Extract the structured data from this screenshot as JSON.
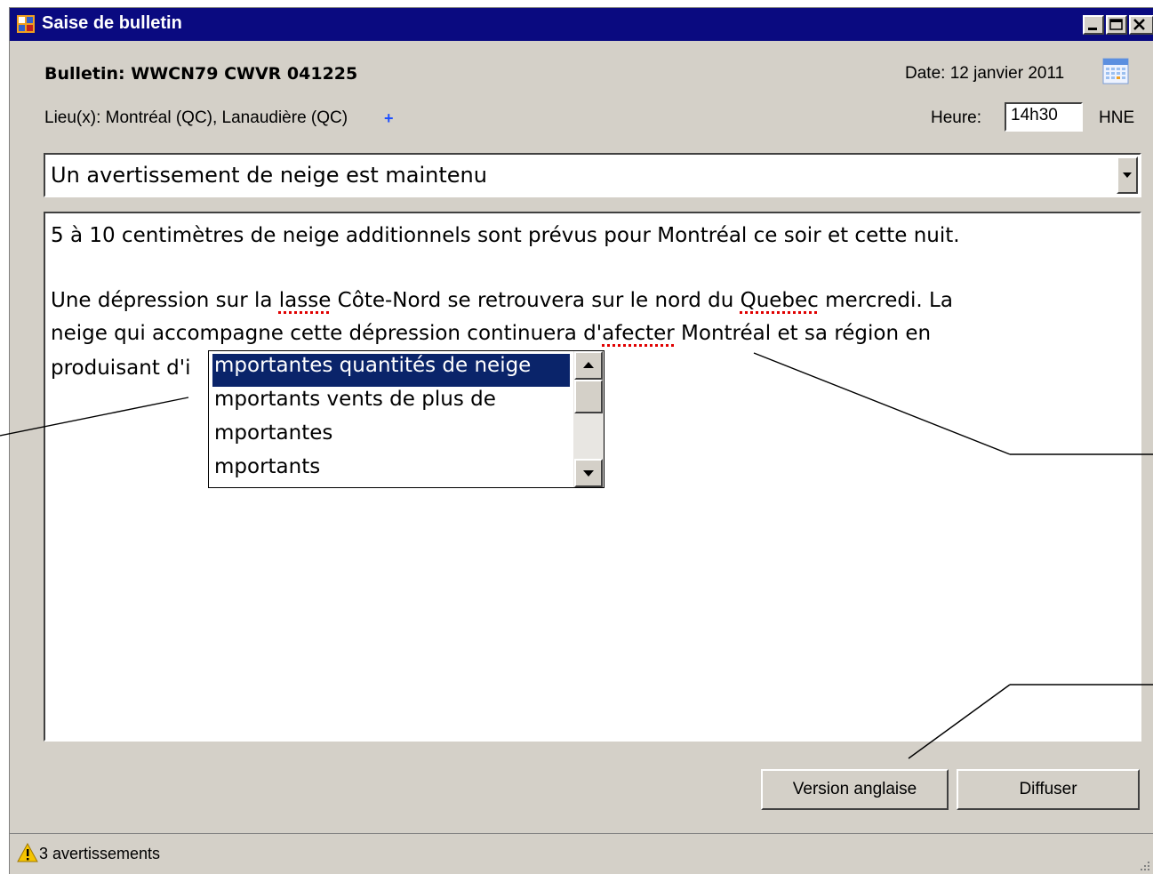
{
  "window": {
    "title": "Saise de bulletin",
    "controls": {
      "minimize": "minimize-icon",
      "maximize": "maximize-icon",
      "close": "close-icon"
    }
  },
  "bulletin": {
    "label": "Bulletin: WWCN79 CWVR 041225"
  },
  "date": {
    "label": "Date: 12 janvier 2011",
    "icon": "calendar-icon"
  },
  "lieux": {
    "label": "Lieu(x): Montréal (QC), Lanaudière (QC)",
    "add_symbol": "+"
  },
  "heure": {
    "label": "Heure:",
    "value": "14h30",
    "tz": "HNE"
  },
  "headline": {
    "selected": "Un avertissement de neige est maintenu"
  },
  "body": {
    "line1": "5 à 10 centimètres de neige additionnels sont prévus pour Montréal ce soir et cette nuit.",
    "line2_a": "Une dépression sur la ",
    "line2_err1": "lasse",
    "line2_b": " Côte-Nord  se retrouvera sur le nord du ",
    "line2_err2": "Quebec",
    "line2_c": " mercredi. La",
    "line3_a": "neige qui accompagne cette dépression continuera d'",
    "line3_err": "afecter",
    "line3_b": " Montréal et sa région en",
    "line4": "produisant d'i"
  },
  "autocomplete": {
    "items": [
      "mportantes quantités de neige",
      "mportants vents de plus de",
      "mportantes",
      "mportants"
    ],
    "selected_index": 0
  },
  "buttons": {
    "english": "Version anglaise",
    "broadcast": "Diffuser"
  },
  "status": {
    "text": "3 avertissements",
    "icon": "warning-icon"
  },
  "colors": {
    "titlebar": "#0a0a80",
    "selection": "#0a246a",
    "spell_error": "#e00000",
    "add_link": "#1e50ff"
  }
}
